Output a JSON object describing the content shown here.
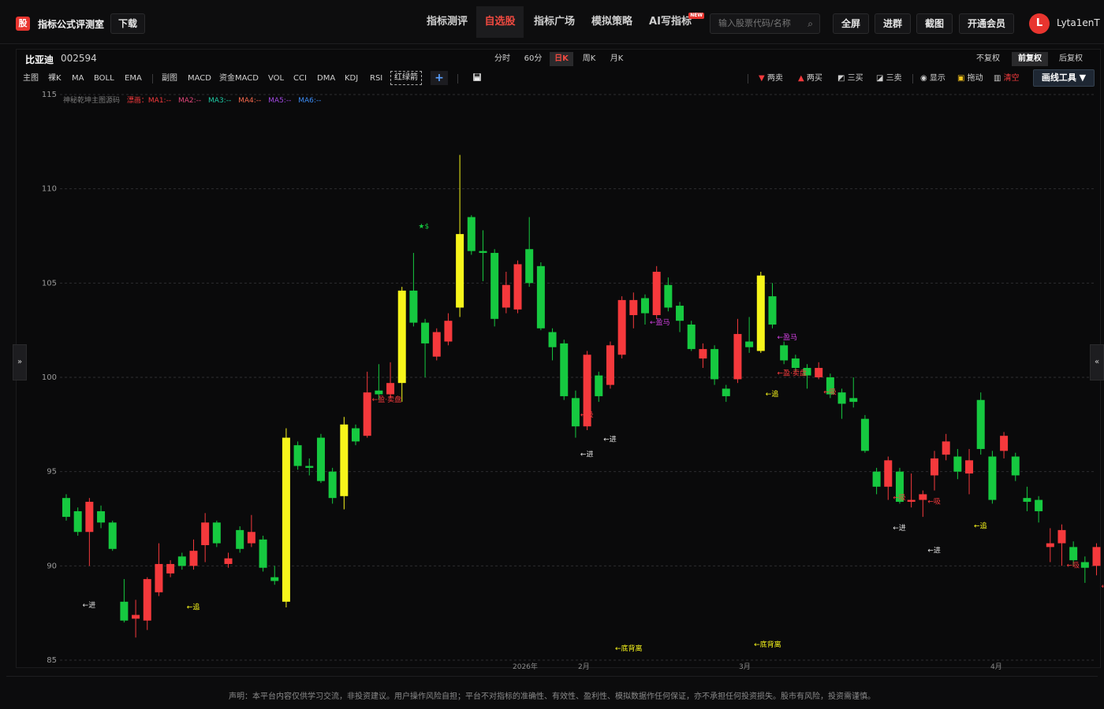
{
  "app": {
    "logo": "股",
    "title": "指标公式评测室",
    "download": "下载"
  },
  "nav": [
    {
      "label": "指标测评",
      "active": false
    },
    {
      "label": "自选股",
      "active": true
    },
    {
      "label": "指标广场",
      "active": false
    },
    {
      "label": "模拟策略",
      "active": false
    },
    {
      "label": "AI写指标",
      "active": false,
      "badge": "NEW"
    }
  ],
  "search": {
    "placeholder": "输入股票代码/名称",
    "icon": "search-icon"
  },
  "header_buttons": {
    "fullscreen": "全屏",
    "join_group": "进群",
    "screenshot": "截图",
    "member": "开通会员"
  },
  "user": {
    "initial": "L",
    "name": "Lyta1enT"
  },
  "stock": {
    "name": "比亚迪",
    "code": "002594"
  },
  "periods": [
    {
      "label": "分时",
      "active": false
    },
    {
      "label": "60分",
      "active": false
    },
    {
      "label": "日K",
      "active": true
    },
    {
      "label": "周K",
      "active": false
    },
    {
      "label": "月K",
      "active": false
    }
  ],
  "adjust": [
    {
      "label": "不复权",
      "active": false
    },
    {
      "label": "前复权",
      "active": true
    },
    {
      "label": "后复权",
      "active": false
    }
  ],
  "toolbar": {
    "main": [
      "主图",
      "裸K",
      "MA",
      "BOLL",
      "EMA"
    ],
    "sub": [
      "副图",
      "MACD",
      "资金MACD",
      "VOL",
      "CCI",
      "DMA",
      "KDJ",
      "RSI"
    ],
    "dashed": "红绿箭",
    "plus": "+",
    "save_icon": "save-icon"
  },
  "signal_tools": {
    "two_sell": "两卖",
    "two_buy": "两买",
    "three_buy": "三买",
    "three_sell": "三卖",
    "show": "显示",
    "drag": "拖动",
    "clear": "清空",
    "draw_tools": "画线工具 ▼"
  },
  "legend": {
    "indicator": "神秘乾坤主图源码",
    "items": [
      "漂画：MA1:--",
      "MA2:--",
      "MA3:--",
      "MA4:--",
      "MA5:--",
      "MA6:--"
    ]
  },
  "side": {
    "left": "»",
    "right": "«"
  },
  "disclaimer": "声明：本平台内容仅供学习交流，非投资建议。用户操作风险自担；平台不对指标的准确性、有效性、盈利性、模拟数据作任何保证，亦不承担任何投资损失。股市有风险，投资需谨慎。",
  "chart_data": {
    "type": "candlestick",
    "y_ticks": [
      85,
      90,
      95,
      100,
      105,
      110,
      115
    ],
    "ylim": [
      85,
      115
    ],
    "x_labels": [
      "2026年",
      "2月",
      "3月",
      "4月"
    ],
    "colors": {
      "up": "#f5393c",
      "down": "#16c940",
      "highlight": "#f7f51b",
      "grid": "#2d2d30"
    },
    "candles": [
      {
        "o": 93.6,
        "c": 92.6,
        "h": 93.8,
        "l": 92.4,
        "t": "down"
      },
      {
        "o": 92.9,
        "c": 91.8,
        "h": 93.1,
        "l": 91.6,
        "t": "down"
      },
      {
        "o": 91.8,
        "c": 93.4,
        "h": 93.6,
        "l": 90.0,
        "t": "up"
      },
      {
        "o": 92.9,
        "c": 92.3,
        "h": 93.2,
        "l": 92.0,
        "t": "down"
      },
      {
        "o": 92.3,
        "c": 90.9,
        "h": 92.4,
        "l": 90.8,
        "t": "down"
      },
      {
        "o": 88.1,
        "c": 87.1,
        "h": 89.3,
        "l": 87.0,
        "t": "down"
      },
      {
        "o": 87.2,
        "c": 87.4,
        "h": 88.2,
        "l": 86.2,
        "t": "up"
      },
      {
        "o": 87.1,
        "c": 89.3,
        "h": 89.4,
        "l": 86.6,
        "t": "up"
      },
      {
        "o": 88.6,
        "c": 90.1,
        "h": 91.2,
        "l": 88.4,
        "t": "up"
      },
      {
        "o": 89.6,
        "c": 90.1,
        "h": 90.3,
        "l": 89.4,
        "t": "up"
      },
      {
        "o": 90.5,
        "c": 90.0,
        "h": 90.7,
        "l": 89.8,
        "t": "down"
      },
      {
        "o": 90.0,
        "c": 90.8,
        "h": 91.4,
        "l": 89.8,
        "t": "up"
      },
      {
        "o": 91.1,
        "c": 92.3,
        "h": 92.8,
        "l": 90.2,
        "t": "up"
      },
      {
        "o": 92.3,
        "c": 91.2,
        "h": 92.4,
        "l": 91.0,
        "t": "down"
      },
      {
        "o": 90.1,
        "c": 90.4,
        "h": 90.7,
        "l": 89.9,
        "t": "up"
      },
      {
        "o": 91.9,
        "c": 90.9,
        "h": 92.1,
        "l": 90.7,
        "t": "down"
      },
      {
        "o": 91.2,
        "c": 91.8,
        "h": 92.7,
        "l": 91.0,
        "t": "up"
      },
      {
        "o": 91.4,
        "c": 89.9,
        "h": 91.6,
        "l": 89.7,
        "t": "down"
      },
      {
        "o": 89.4,
        "c": 89.2,
        "h": 90.0,
        "l": 89.0,
        "t": "down"
      },
      {
        "o": 88.1,
        "c": 96.8,
        "h": 97.3,
        "l": 87.8,
        "t": "highlight"
      },
      {
        "o": 96.4,
        "c": 95.3,
        "h": 96.6,
        "l": 95.1,
        "t": "down"
      },
      {
        "o": 95.3,
        "c": 95.2,
        "h": 95.7,
        "l": 94.8,
        "t": "down"
      },
      {
        "o": 96.8,
        "c": 94.5,
        "h": 97.0,
        "l": 94.4,
        "t": "down"
      },
      {
        "o": 95.0,
        "c": 93.6,
        "h": 95.2,
        "l": 93.3,
        "t": "down"
      },
      {
        "o": 93.7,
        "c": 97.5,
        "h": 97.9,
        "l": 93.0,
        "t": "highlight"
      },
      {
        "o": 97.3,
        "c": 96.6,
        "h": 97.5,
        "l": 96.4,
        "t": "down"
      },
      {
        "o": 96.9,
        "c": 99.2,
        "h": 100.3,
        "l": 96.8,
        "t": "up"
      },
      {
        "o": 99.3,
        "c": 99.1,
        "h": 100.7,
        "l": 98.8,
        "t": "down"
      },
      {
        "o": 99.1,
        "c": 99.7,
        "h": 100.8,
        "l": 98.9,
        "t": "up"
      },
      {
        "o": 99.7,
        "c": 104.6,
        "h": 104.8,
        "l": 98.7,
        "t": "highlight"
      },
      {
        "o": 104.6,
        "c": 102.9,
        "h": 106.6,
        "l": 102.7,
        "t": "down"
      },
      {
        "o": 102.9,
        "c": 101.8,
        "h": 103.1,
        "l": 100.0,
        "t": "down"
      },
      {
        "o": 101.1,
        "c": 102.4,
        "h": 102.6,
        "l": 100.9,
        "t": "up"
      },
      {
        "o": 101.9,
        "c": 103.0,
        "h": 103.4,
        "l": 101.7,
        "t": "up"
      },
      {
        "o": 103.7,
        "c": 107.6,
        "h": 111.8,
        "l": 103.2,
        "t": "highlight"
      },
      {
        "o": 108.5,
        "c": 106.7,
        "h": 108.6,
        "l": 106.5,
        "t": "down"
      },
      {
        "o": 106.7,
        "c": 106.6,
        "h": 107.8,
        "l": 105.1,
        "t": "down"
      },
      {
        "o": 106.6,
        "c": 103.1,
        "h": 106.8,
        "l": 102.7,
        "t": "down"
      },
      {
        "o": 103.7,
        "c": 104.9,
        "h": 105.6,
        "l": 103.4,
        "t": "up"
      },
      {
        "o": 103.6,
        "c": 106.0,
        "h": 106.2,
        "l": 103.4,
        "t": "up"
      },
      {
        "o": 106.8,
        "c": 105.0,
        "h": 108.5,
        "l": 104.8,
        "t": "down"
      },
      {
        "o": 105.9,
        "c": 102.6,
        "h": 106.1,
        "l": 102.5,
        "t": "down"
      },
      {
        "o": 102.4,
        "c": 101.6,
        "h": 102.6,
        "l": 100.9,
        "t": "down"
      },
      {
        "o": 101.8,
        "c": 99.0,
        "h": 102.0,
        "l": 98.8,
        "t": "down"
      },
      {
        "o": 98.9,
        "c": 97.4,
        "h": 99.3,
        "l": 96.8,
        "t": "down"
      },
      {
        "o": 97.4,
        "c": 101.2,
        "h": 101.4,
        "l": 97.2,
        "t": "up"
      },
      {
        "o": 100.1,
        "c": 99.0,
        "h": 100.3,
        "l": 98.7,
        "t": "down"
      },
      {
        "o": 99.6,
        "c": 101.7,
        "h": 101.9,
        "l": 99.4,
        "t": "up"
      },
      {
        "o": 101.2,
        "c": 104.1,
        "h": 104.3,
        "l": 101.0,
        "t": "up"
      },
      {
        "o": 104.1,
        "c": 103.3,
        "h": 104.5,
        "l": 102.6,
        "t": "up"
      },
      {
        "o": 104.2,
        "c": 103.4,
        "h": 104.4,
        "l": 102.8,
        "t": "down"
      },
      {
        "o": 103.3,
        "c": 105.6,
        "h": 105.9,
        "l": 103.1,
        "t": "up"
      },
      {
        "o": 104.9,
        "c": 103.7,
        "h": 105.3,
        "l": 103.5,
        "t": "down"
      },
      {
        "o": 103.8,
        "c": 103.0,
        "h": 104.0,
        "l": 102.4,
        "t": "down"
      },
      {
        "o": 102.8,
        "c": 101.5,
        "h": 103.0,
        "l": 101.4,
        "t": "down"
      },
      {
        "o": 101.0,
        "c": 101.5,
        "h": 101.8,
        "l": 100.5,
        "t": "up"
      },
      {
        "o": 101.5,
        "c": 99.9,
        "h": 101.7,
        "l": 99.6,
        "t": "down"
      },
      {
        "o": 99.4,
        "c": 99.0,
        "h": 99.6,
        "l": 98.7,
        "t": "down"
      },
      {
        "o": 99.9,
        "c": 102.3,
        "h": 103.1,
        "l": 99.7,
        "t": "up"
      },
      {
        "o": 101.6,
        "c": 101.9,
        "h": 103.2,
        "l": 101.3,
        "t": "down"
      },
      {
        "o": 101.4,
        "c": 105.4,
        "h": 105.6,
        "l": 101.3,
        "t": "highlight"
      },
      {
        "o": 104.3,
        "c": 102.8,
        "h": 105.0,
        "l": 102.6,
        "t": "down"
      },
      {
        "o": 101.7,
        "c": 100.9,
        "h": 101.9,
        "l": 100.7,
        "t": "down"
      },
      {
        "o": 101.0,
        "c": 100.5,
        "h": 101.2,
        "l": 100.3,
        "t": "down"
      },
      {
        "o": 100.5,
        "c": 100.1,
        "h": 100.7,
        "l": 99.4,
        "t": "down"
      },
      {
        "o": 100.0,
        "c": 100.5,
        "h": 100.8,
        "l": 99.9,
        "t": "up"
      },
      {
        "o": 100.0,
        "c": 99.1,
        "h": 100.2,
        "l": 98.9,
        "t": "down"
      },
      {
        "o": 99.2,
        "c": 98.6,
        "h": 99.4,
        "l": 97.8,
        "t": "down"
      },
      {
        "o": 98.9,
        "c": 98.7,
        "h": 100.0,
        "l": 98.4,
        "t": "down"
      },
      {
        "o": 97.8,
        "c": 96.1,
        "h": 98.0,
        "l": 96.0,
        "t": "down"
      },
      {
        "o": 95.0,
        "c": 94.2,
        "h": 95.2,
        "l": 93.8,
        "t": "down"
      },
      {
        "o": 94.2,
        "c": 95.6,
        "h": 95.8,
        "l": 93.5,
        "t": "up"
      },
      {
        "o": 95.0,
        "c": 93.4,
        "h": 95.2,
        "l": 93.3,
        "t": "down"
      },
      {
        "o": 93.4,
        "c": 93.5,
        "h": 94.9,
        "l": 93.1,
        "t": "up"
      },
      {
        "o": 93.5,
        "c": 93.8,
        "h": 94.0,
        "l": 92.6,
        "t": "up"
      },
      {
        "o": 94.8,
        "c": 95.7,
        "h": 96.1,
        "l": 94.0,
        "t": "up"
      },
      {
        "o": 95.9,
        "c": 96.6,
        "h": 97.0,
        "l": 95.6,
        "t": "up"
      },
      {
        "o": 95.8,
        "c": 95.0,
        "h": 96.2,
        "l": 94.6,
        "t": "down"
      },
      {
        "o": 94.9,
        "c": 95.6,
        "h": 96.2,
        "l": 93.8,
        "t": "up"
      },
      {
        "o": 98.8,
        "c": 96.2,
        "h": 99.2,
        "l": 95.9,
        "t": "down"
      },
      {
        "o": 95.8,
        "c": 93.5,
        "h": 96.1,
        "l": 93.3,
        "t": "down"
      },
      {
        "o": 96.1,
        "c": 96.9,
        "h": 97.1,
        "l": 95.7,
        "t": "up"
      },
      {
        "o": 95.8,
        "c": 94.8,
        "h": 96.0,
        "l": 94.5,
        "t": "down"
      },
      {
        "o": 93.6,
        "c": 93.4,
        "h": 94.2,
        "l": 92.9,
        "t": "down"
      },
      {
        "o": 93.5,
        "c": 92.9,
        "h": 93.7,
        "l": 92.3,
        "t": "down"
      },
      {
        "o": 91.0,
        "c": 91.2,
        "h": 92.0,
        "l": 90.2,
        "t": "up"
      },
      {
        "o": 91.2,
        "c": 91.9,
        "h": 92.2,
        "l": 90.0,
        "t": "up"
      },
      {
        "o": 91.0,
        "c": 90.3,
        "h": 91.3,
        "l": 90.0,
        "t": "down"
      },
      {
        "o": 90.2,
        "c": 89.9,
        "h": 90.5,
        "l": 89.1,
        "t": "down"
      },
      {
        "o": 90.0,
        "c": 91.0,
        "h": 91.2,
        "l": 89.5,
        "t": "up"
      }
    ],
    "annotations": [
      {
        "i": 1,
        "y": 87.8,
        "text": "←进",
        "color": "#e0e0e0"
      },
      {
        "i": 10,
        "y": 87.7,
        "text": "←追",
        "color": "#f7f51b"
      },
      {
        "i": 26,
        "y": 98.7,
        "text": "←盈·卖盘",
        "color": "#f5393c"
      },
      {
        "i": 44,
        "y": 97.9,
        "text": "←吸",
        "color": "#f5393c"
      },
      {
        "i": 46,
        "y": 96.6,
        "text": "←进",
        "color": "#e0e0e0"
      },
      {
        "i": 44,
        "y": 95.8,
        "text": "←进",
        "color": "#e0e0e0"
      },
      {
        "i": 50,
        "y": 102.8,
        "text": "←盈马",
        "color": "#d040e0"
      },
      {
        "i": 61,
        "y": 102.0,
        "text": "←盈马",
        "color": "#d040e0"
      },
      {
        "i": 61,
        "y": 100.1,
        "text": "←盈·卖盘",
        "color": "#f5393c"
      },
      {
        "i": 60,
        "y": 99.0,
        "text": "←追",
        "color": "#f7f51b"
      },
      {
        "i": 65,
        "y": 99.1,
        "text": "←吸",
        "color": "#f5393c"
      },
      {
        "i": 71,
        "y": 93.5,
        "text": "←吸",
        "color": "#f5393c"
      },
      {
        "i": 74,
        "y": 93.3,
        "text": "←吸",
        "color": "#f5393c"
      },
      {
        "i": 71,
        "y": 91.9,
        "text": "←进",
        "color": "#e0e0e0"
      },
      {
        "i": 74,
        "y": 90.7,
        "text": "←进",
        "color": "#e0e0e0"
      },
      {
        "i": 78,
        "y": 92.0,
        "text": "←追",
        "color": "#f7f51b"
      },
      {
        "i": 86,
        "y": 89.9,
        "text": "←吸",
        "color": "#f5393c"
      },
      {
        "i": 89,
        "y": 88.8,
        "text": "←吸",
        "color": "#f5393c"
      },
      {
        "i": 90,
        "y": 87.1,
        "text": "←进",
        "color": "#e0e0e0"
      },
      {
        "i": 47,
        "y": 85.5,
        "text": "←底背离",
        "color": "#f7f51b"
      },
      {
        "i": 59,
        "y": 85.7,
        "text": "←底背离",
        "color": "#f7f51b"
      },
      {
        "i": 30,
        "y": 107.9,
        "text": "★$",
        "color": "#16c940"
      }
    ]
  }
}
